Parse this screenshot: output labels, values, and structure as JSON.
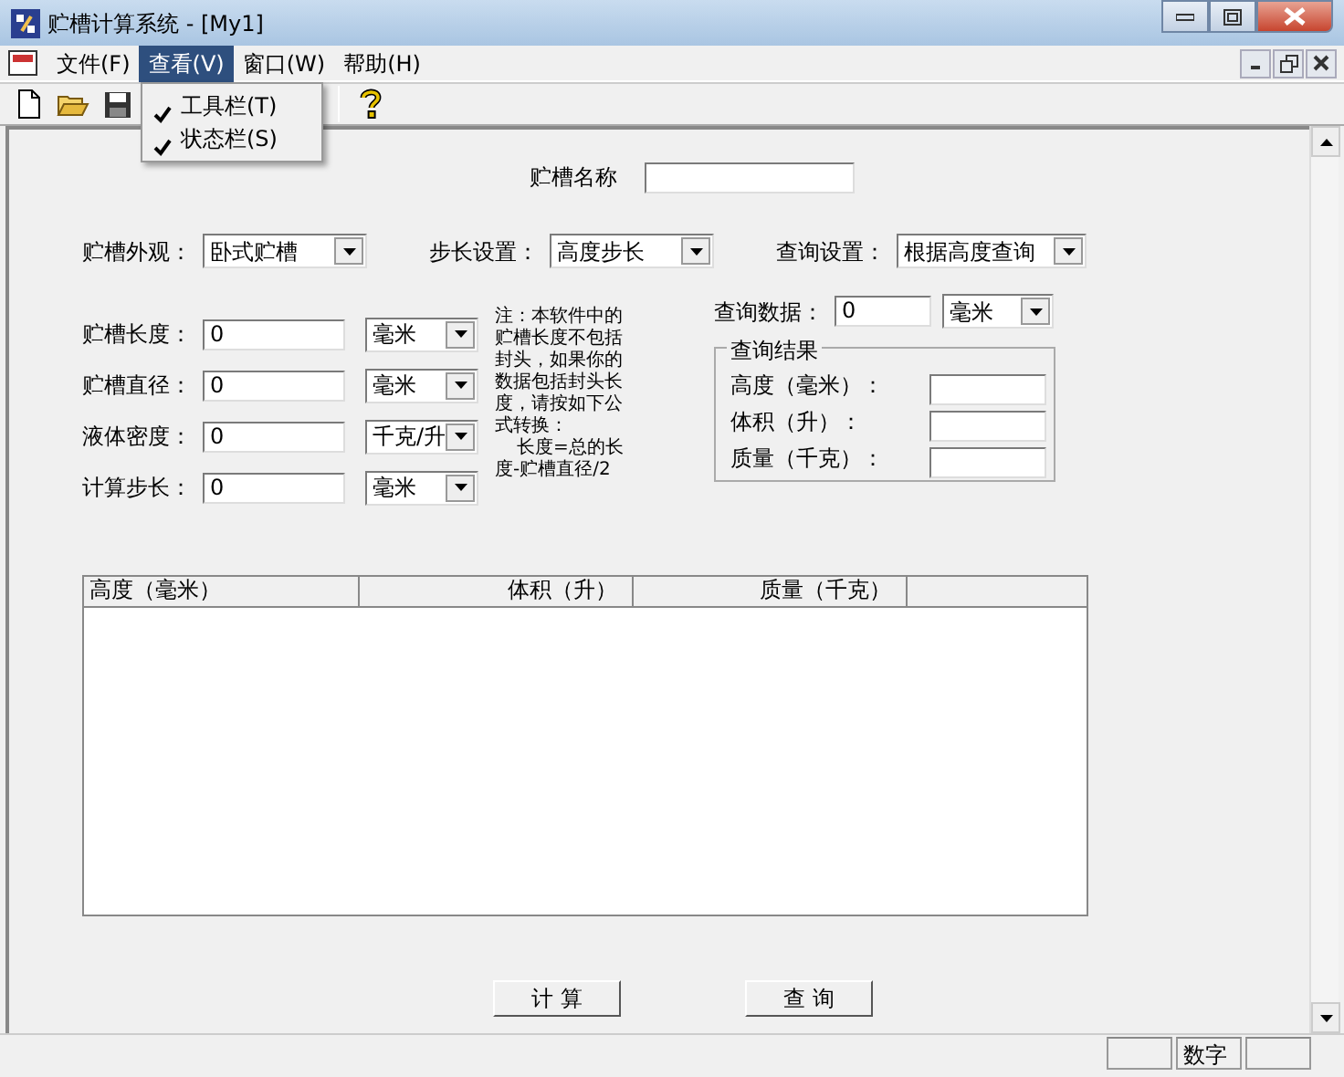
{
  "window": {
    "title": "贮槽计算系统 - [My1]"
  },
  "menu": [
    {
      "label": "文件(F)",
      "selected": false
    },
    {
      "label": "查看(V)",
      "selected": true
    },
    {
      "label": "窗口(W)",
      "selected": false
    },
    {
      "label": "帮助(H)",
      "selected": false
    }
  ],
  "view_menu": {
    "items": [
      {
        "label": "工具栏(T)",
        "checked": true
      },
      {
        "label": "状态栏(S)",
        "checked": true
      }
    ]
  },
  "form": {
    "tank_name": {
      "label": "贮槽名称"
    },
    "settings": [
      {
        "label": "贮槽外观：",
        "value": "卧式贮槽"
      },
      {
        "label": "步长设置：",
        "value": "高度步长"
      },
      {
        "label": "查询设置：",
        "value": "根据高度查询"
      }
    ],
    "fields": [
      {
        "label": "贮槽长度：",
        "value": "0",
        "unit": "毫米"
      },
      {
        "label": "贮槽直径：",
        "value": "0",
        "unit": "毫米"
      },
      {
        "label": "液体密度：",
        "value": "0",
        "unit": "千克/升"
      },
      {
        "label": "计算步长：",
        "value": "0",
        "unit": "毫米"
      }
    ],
    "note": "注：本软件中的贮槽长度不包括封头，如果你的数据包括封头长度，请按如下公式转换：",
    "formula": "长度=总的长度-贮槽直径/2",
    "query": {
      "label": "查询数据：",
      "value": "0",
      "unit": "毫米"
    },
    "result": {
      "title": "查询结果",
      "rows": [
        {
          "label": "高度（毫米）："
        },
        {
          "label": "体积（升）："
        },
        {
          "label": "质量（千克）："
        }
      ]
    },
    "table": {
      "columns": [
        "高度（毫米）",
        "体积（升）",
        "质量（千克）"
      ]
    },
    "buttons": [
      "计 算",
      "查 询"
    ]
  },
  "status_bar": {
    "panels": [
      "数字"
    ]
  }
}
